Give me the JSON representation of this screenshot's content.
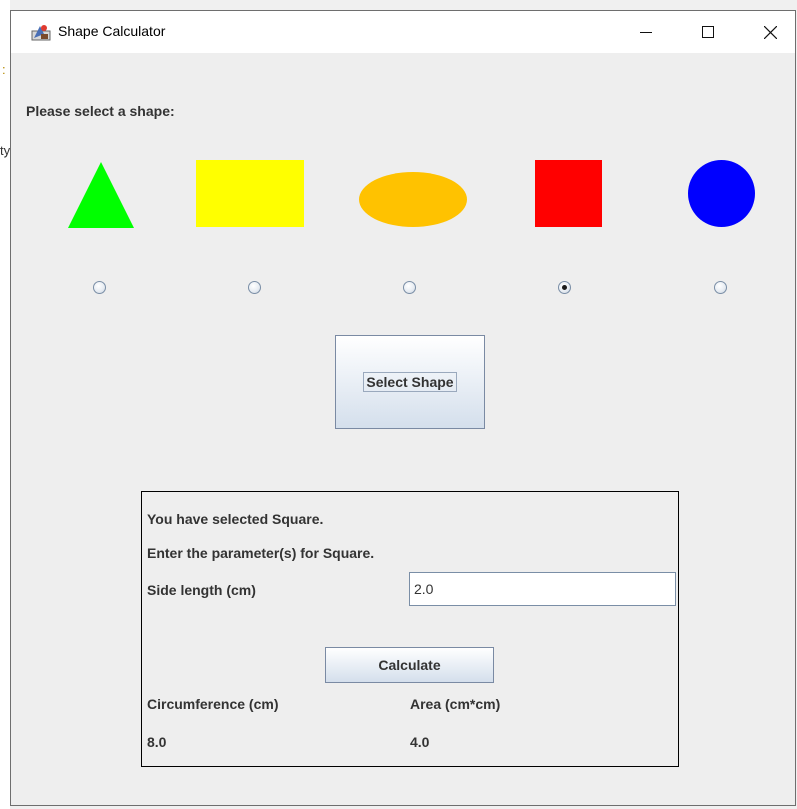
{
  "window": {
    "title": "Shape Calculator",
    "controls": [
      "minimize",
      "maximize",
      "close"
    ]
  },
  "background_fragments": {
    "left_chars": [
      ":",
      "ty"
    ]
  },
  "prompt": "Please select a shape:",
  "shapes": [
    {
      "name": "triangle",
      "color": "#00ff00",
      "selected": false
    },
    {
      "name": "rectangle",
      "color": "#ffff00",
      "selected": false
    },
    {
      "name": "ellipse",
      "color": "#ffc200",
      "selected": false
    },
    {
      "name": "square",
      "color": "#ff0000",
      "selected": true
    },
    {
      "name": "circle",
      "color": "#0000ff",
      "selected": false
    }
  ],
  "select_button_label": "Select Shape",
  "panel": {
    "selected_text": "You have selected Square.",
    "instruction_text": "Enter the parameter(s) for Square.",
    "param_label": "Side length (cm)",
    "param_value": "2.0",
    "calculate_label": "Calculate",
    "circumference_label": "Circumference (cm)",
    "area_label": "Area (cm*cm)",
    "circumference_value": "8.0",
    "area_value": "4.0"
  }
}
